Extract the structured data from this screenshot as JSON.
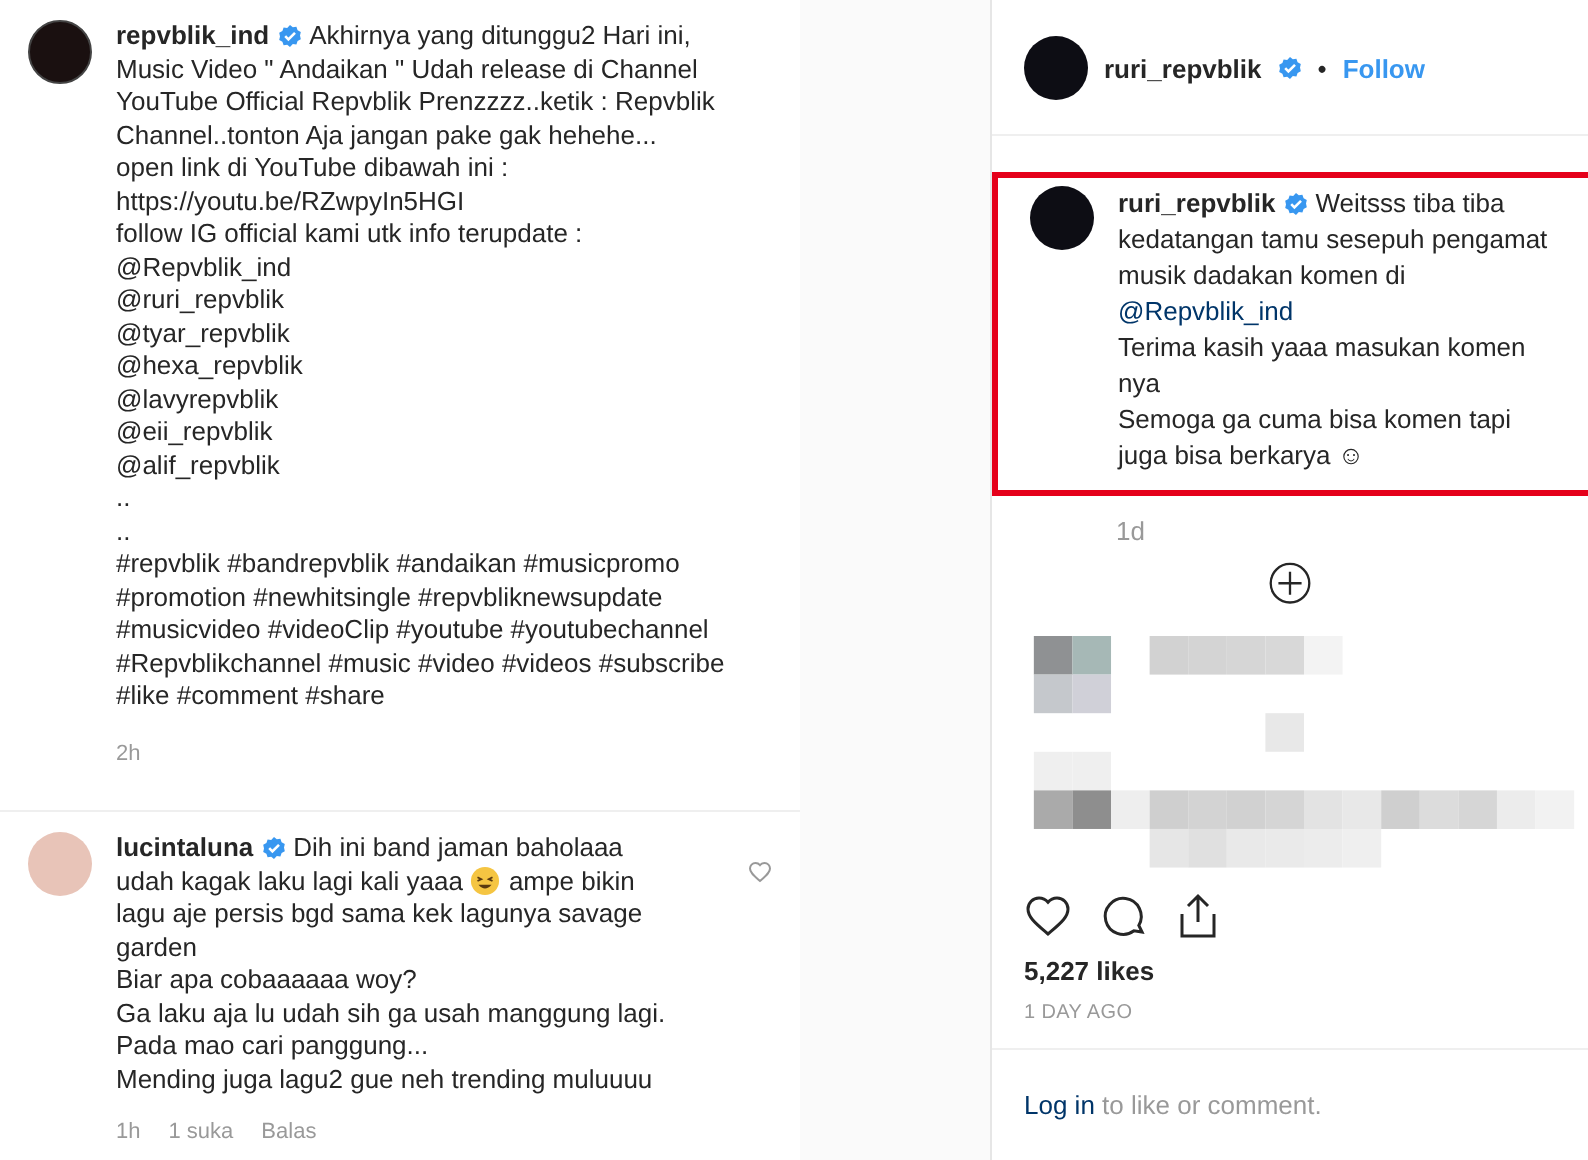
{
  "post_caption": {
    "author": "repvblik_ind",
    "verified": true,
    "lines": [
      [
        {
          "kind": "text",
          "text": "Akhirnya yang ditunggu2 Hari ini,"
        }
      ],
      [
        {
          "kind": "text",
          "text": "Music Video \" Andaikan \" Udah release di Channel"
        }
      ],
      [
        {
          "kind": "text",
          "text": "YouTube Official Repvblik Prenzzzz..ketik : Repvblik"
        }
      ],
      [
        {
          "kind": "text",
          "text": "Channel..tonton Aja jangan pake gak hehehe..."
        }
      ],
      [
        {
          "kind": "text",
          "text": "open link di YouTube dibawah ini :"
        }
      ],
      [
        {
          "kind": "text",
          "text": "https://youtu.be/RZwpyIn5HGI"
        }
      ],
      [
        {
          "kind": "text",
          "text": "follow IG official kami utk info terupdate :"
        }
      ],
      [
        {
          "kind": "text",
          "text": "@Repvblik_ind"
        }
      ],
      [
        {
          "kind": "text",
          "text": "@ruri_repvblik"
        }
      ],
      [
        {
          "kind": "text",
          "text": "@tyar_repvblik"
        }
      ],
      [
        {
          "kind": "text",
          "text": "@hexa_repvblik"
        }
      ],
      [
        {
          "kind": "text",
          "text": "@lavyrepvblik"
        }
      ],
      [
        {
          "kind": "text",
          "text": "@eii_repvblik"
        }
      ],
      [
        {
          "kind": "text",
          "text": "@alif_repvblik"
        }
      ],
      [
        {
          "kind": "text",
          "text": ".."
        }
      ],
      [
        {
          "kind": "text",
          "text": ".."
        }
      ],
      [
        {
          "kind": "text",
          "text": "#repvblik #bandrepvblik #andaikan #musicpromo"
        }
      ],
      [
        {
          "kind": "text",
          "text": "#promotion #newhitsingle #repvbliknewsupdate"
        }
      ],
      [
        {
          "kind": "text",
          "text": "#musicvideo #videoClip #youtube #youtubechannel"
        }
      ],
      [
        {
          "kind": "text",
          "text": "#Repvblikchannel #music #video #videos #subscribe"
        }
      ],
      [
        {
          "kind": "text",
          "text": "#like #comment #share"
        }
      ]
    ],
    "time": "2h"
  },
  "comment": {
    "author": "lucintaluna",
    "verified": true,
    "lines": [
      [
        {
          "kind": "text",
          "text": "Dih ini band jaman baholaaa"
        }
      ],
      [
        {
          "kind": "text",
          "text": "udah kagak laku lagi kali yaaa"
        },
        {
          "kind": "emoji"
        },
        {
          "kind": "text",
          "text": "ampe bikin"
        }
      ],
      [
        {
          "kind": "text",
          "text": "lagu aje persis bgd sama kek lagunya savage"
        }
      ],
      [
        {
          "kind": "text",
          "text": "garden"
        }
      ],
      [
        {
          "kind": "text",
          "text": "Biar apa cobaaaaaa woy?"
        }
      ],
      [
        {
          "kind": "text",
          "text": "Ga laku aja lu udah sih ga usah manggung lagi."
        }
      ],
      [
        {
          "kind": "text",
          "text": "Pada mao cari panggung..."
        }
      ],
      [
        {
          "kind": "text",
          "text": "Mending juga lagu2 gue neh trending muluuuu"
        }
      ]
    ],
    "time": "1h",
    "likes": "1 suka",
    "reply": "Balas"
  },
  "post_header": {
    "author": "ruri_repvblik",
    "verified": true,
    "separator": "•",
    "follow": "Follow"
  },
  "highlighted_comment": {
    "author": "ruri_repvblik",
    "verified": true,
    "lines": [
      [
        {
          "kind": "text",
          "text": "Weitsss tiba tiba"
        }
      ],
      [
        {
          "kind": "text",
          "text": "kedatangan tamu sesepuh pengamat"
        }
      ],
      [
        {
          "kind": "text",
          "text": "musik dadakan komen di"
        }
      ],
      [
        {
          "kind": "mention",
          "text": "@Repvblik_ind"
        }
      ],
      [
        {
          "kind": "text",
          "text": "Terima kasih yaaa masukan komen"
        }
      ],
      [
        {
          "kind": "text",
          "text": "nya"
        }
      ],
      [
        {
          "kind": "text",
          "text": "Semoga ga cuma bisa komen tapi"
        }
      ],
      [
        {
          "kind": "text",
          "text": "juga bisa berkarya ☺"
        }
      ]
    ],
    "time": "1d"
  },
  "likes": "5,227 likes",
  "date": "1 DAY AGO",
  "login_prompt": {
    "link": "Log in",
    "rest": "to like or comment."
  }
}
